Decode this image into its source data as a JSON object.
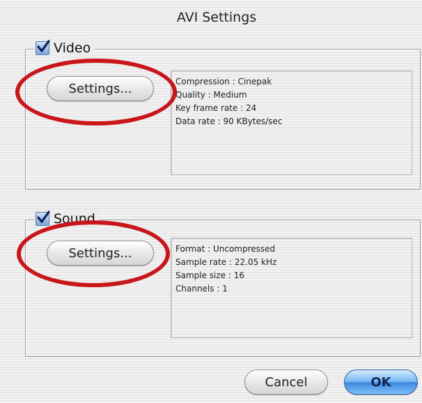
{
  "window": {
    "title": "AVI Settings"
  },
  "video": {
    "label": "Video",
    "checked": true,
    "settings_button": "Settings...",
    "info": [
      "Compression : Cinepak",
      "Quality : Medium",
      "Key frame rate : 24",
      "Data rate : 90 KBytes/sec"
    ]
  },
  "sound": {
    "label": "Sound",
    "checked": true,
    "settings_button": "Settings...",
    "info": [
      "Format : Uncompressed",
      "Sample rate : 22.05 kHz",
      "Sample size : 16",
      "Channels : 1"
    ]
  },
  "buttons": {
    "cancel": "Cancel",
    "ok": "OK"
  },
  "colors": {
    "highlight_ring": "#c8161a",
    "default_button": "#3b86dd"
  }
}
